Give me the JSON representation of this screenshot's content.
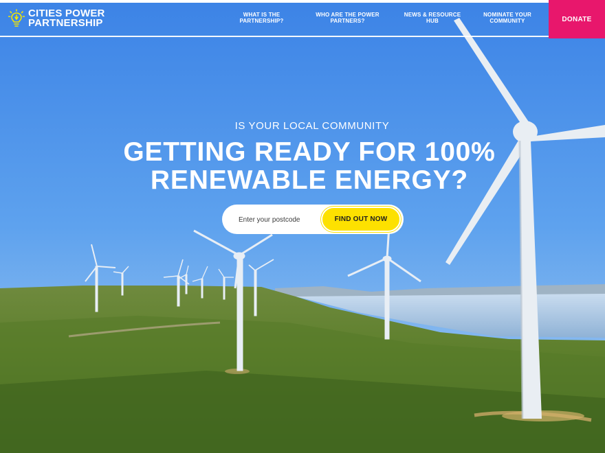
{
  "brand": {
    "line1": "CITIES POWER",
    "line2": "PARTNERSHIP",
    "logo_icon": "lightbulb-icon",
    "logo_color": "#f3e600"
  },
  "nav": {
    "items": [
      {
        "line1": "WHAT IS THE",
        "line2": "PARTNERSHIP?"
      },
      {
        "line1": "WHO ARE THE POWER",
        "line2": "PARTNERS?"
      },
      {
        "line1": "NEWS & RESOURCE",
        "line2": "HUB"
      },
      {
        "line1": "NOMINATE YOUR",
        "line2": "COMMUNITY"
      }
    ],
    "donate_label": "DONATE"
  },
  "hero": {
    "eyebrow": "IS YOUR LOCAL COMMUNITY",
    "headline_line1": "GETTING READY FOR 100%",
    "headline_line2": "RENEWABLE ENERGY?"
  },
  "search": {
    "placeholder": "Enter your postcode",
    "value": "",
    "button_label": "FIND OUT NOW"
  },
  "colors": {
    "accent_pink": "#e8176c",
    "accent_yellow": "#fde100",
    "text_white": "#ffffff"
  }
}
